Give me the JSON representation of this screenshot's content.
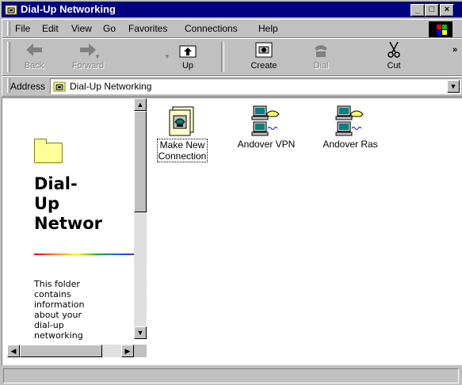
{
  "window": {
    "title": "Dial-Up Networking",
    "controls": {
      "minimize": "_",
      "maximize": "□",
      "close": "×"
    }
  },
  "menu": {
    "items": [
      {
        "label": "File"
      },
      {
        "label": "Edit"
      },
      {
        "label": "View"
      },
      {
        "label": "Go"
      },
      {
        "label": "Favorites"
      },
      {
        "label": "Connections"
      },
      {
        "label": "Help"
      }
    ]
  },
  "toolbar": {
    "back": "Back",
    "forward": "Forward",
    "up": "Up",
    "create": "Create",
    "dial": "Dial",
    "cut": "Cut",
    "more": "»"
  },
  "address": {
    "label": "Address",
    "value": "Dial-Up Networking"
  },
  "left_pane": {
    "title_lines": [
      "Dial-",
      "Up",
      "Networ"
    ],
    "description_lines": [
      "This folder",
      "contains",
      "information",
      "about your",
      "dial-up",
      "networking"
    ]
  },
  "items": [
    {
      "caption_lines": [
        "Make New",
        "Connection"
      ],
      "icon": "make-new-connection-icon",
      "selected": true
    },
    {
      "caption_lines": [
        "Andover VPN"
      ],
      "icon": "dialup-connection-icon",
      "selected": false
    },
    {
      "caption_lines": [
        "Andover Ras"
      ],
      "icon": "dialup-connection-icon",
      "selected": false
    }
  ],
  "colors": {
    "titlebar": "#000080",
    "face": "#c0c0c0"
  }
}
